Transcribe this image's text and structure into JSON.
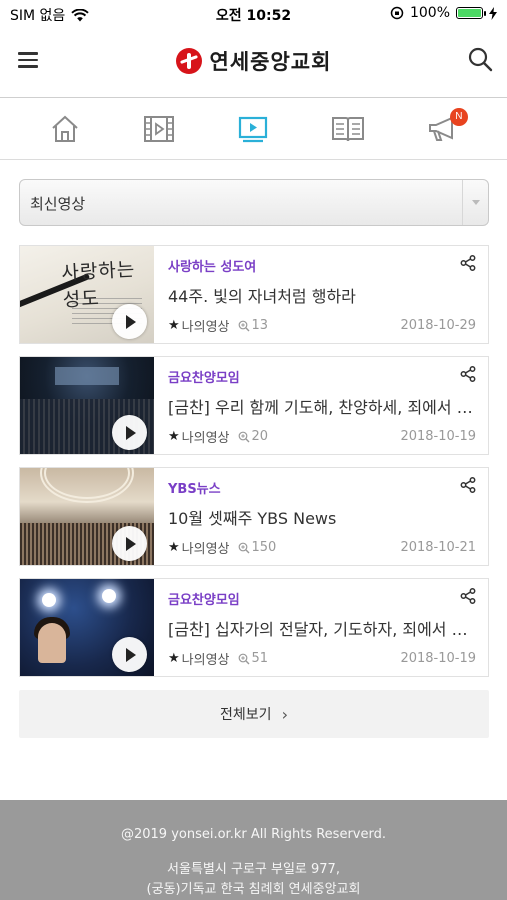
{
  "status_bar": {
    "carrier": "SIM 없음",
    "time": "오전 10:52",
    "battery": "100%",
    "battery_level": 1.0
  },
  "header": {
    "logo_text": "연세중앙교회",
    "icons": {
      "menu": "hamburger-menu-icon",
      "search": "search-icon"
    }
  },
  "nav": {
    "items": [
      {
        "name": "home",
        "icon": "home-icon",
        "active": false
      },
      {
        "name": "video-film",
        "icon": "film-icon",
        "active": false
      },
      {
        "name": "video-play",
        "icon": "play-screen-icon",
        "active": true
      },
      {
        "name": "book",
        "icon": "book-icon",
        "active": false
      },
      {
        "name": "notice",
        "icon": "megaphone-icon",
        "active": false,
        "badge": "N"
      }
    ],
    "colors": {
      "active": "#2ab0d8",
      "inactive": "#8a8a8a",
      "badge": "#e8431f"
    }
  },
  "filter": {
    "selected": "최신영상"
  },
  "videos": [
    {
      "category": "사랑하는 성도여",
      "title": "44주. 빛의 자녀처럼 행하라",
      "mylist_label": "나의영상",
      "views": "13",
      "date": "2018-10-29",
      "thumb_text": "사랑하는 성도"
    },
    {
      "category": "금요찬양모임",
      "title": "[금찬] 우리 함께 기도해, 찬양하세, 죄에서 …",
      "mylist_label": "나의영상",
      "views": "20",
      "date": "2018-10-19"
    },
    {
      "category": "YBS뉴스",
      "title": "10월 셋째주 YBS News",
      "mylist_label": "나의영상",
      "views": "150",
      "date": "2018-10-21"
    },
    {
      "category": "금요찬양모임",
      "title": "[금찬] 십자가의 전달자, 기도하자, 죄에서 …",
      "mylist_label": "나의영상",
      "views": "51",
      "date": "2018-10-19"
    }
  ],
  "more_button": {
    "label": "전체보기",
    "chevron": "›"
  },
  "footer": {
    "copyright": "@2019 yonsei.or.kr All Rights Reserverd.",
    "address_line1": "서울특별시 구로구 부일로 977,",
    "address_line2": "(궁동)기독교 한국 침례회 연세중앙교회"
  },
  "colors": {
    "category": "#7a3fc6",
    "footer_bg": "#9a9a9a",
    "brand_red": "#d7141a"
  }
}
